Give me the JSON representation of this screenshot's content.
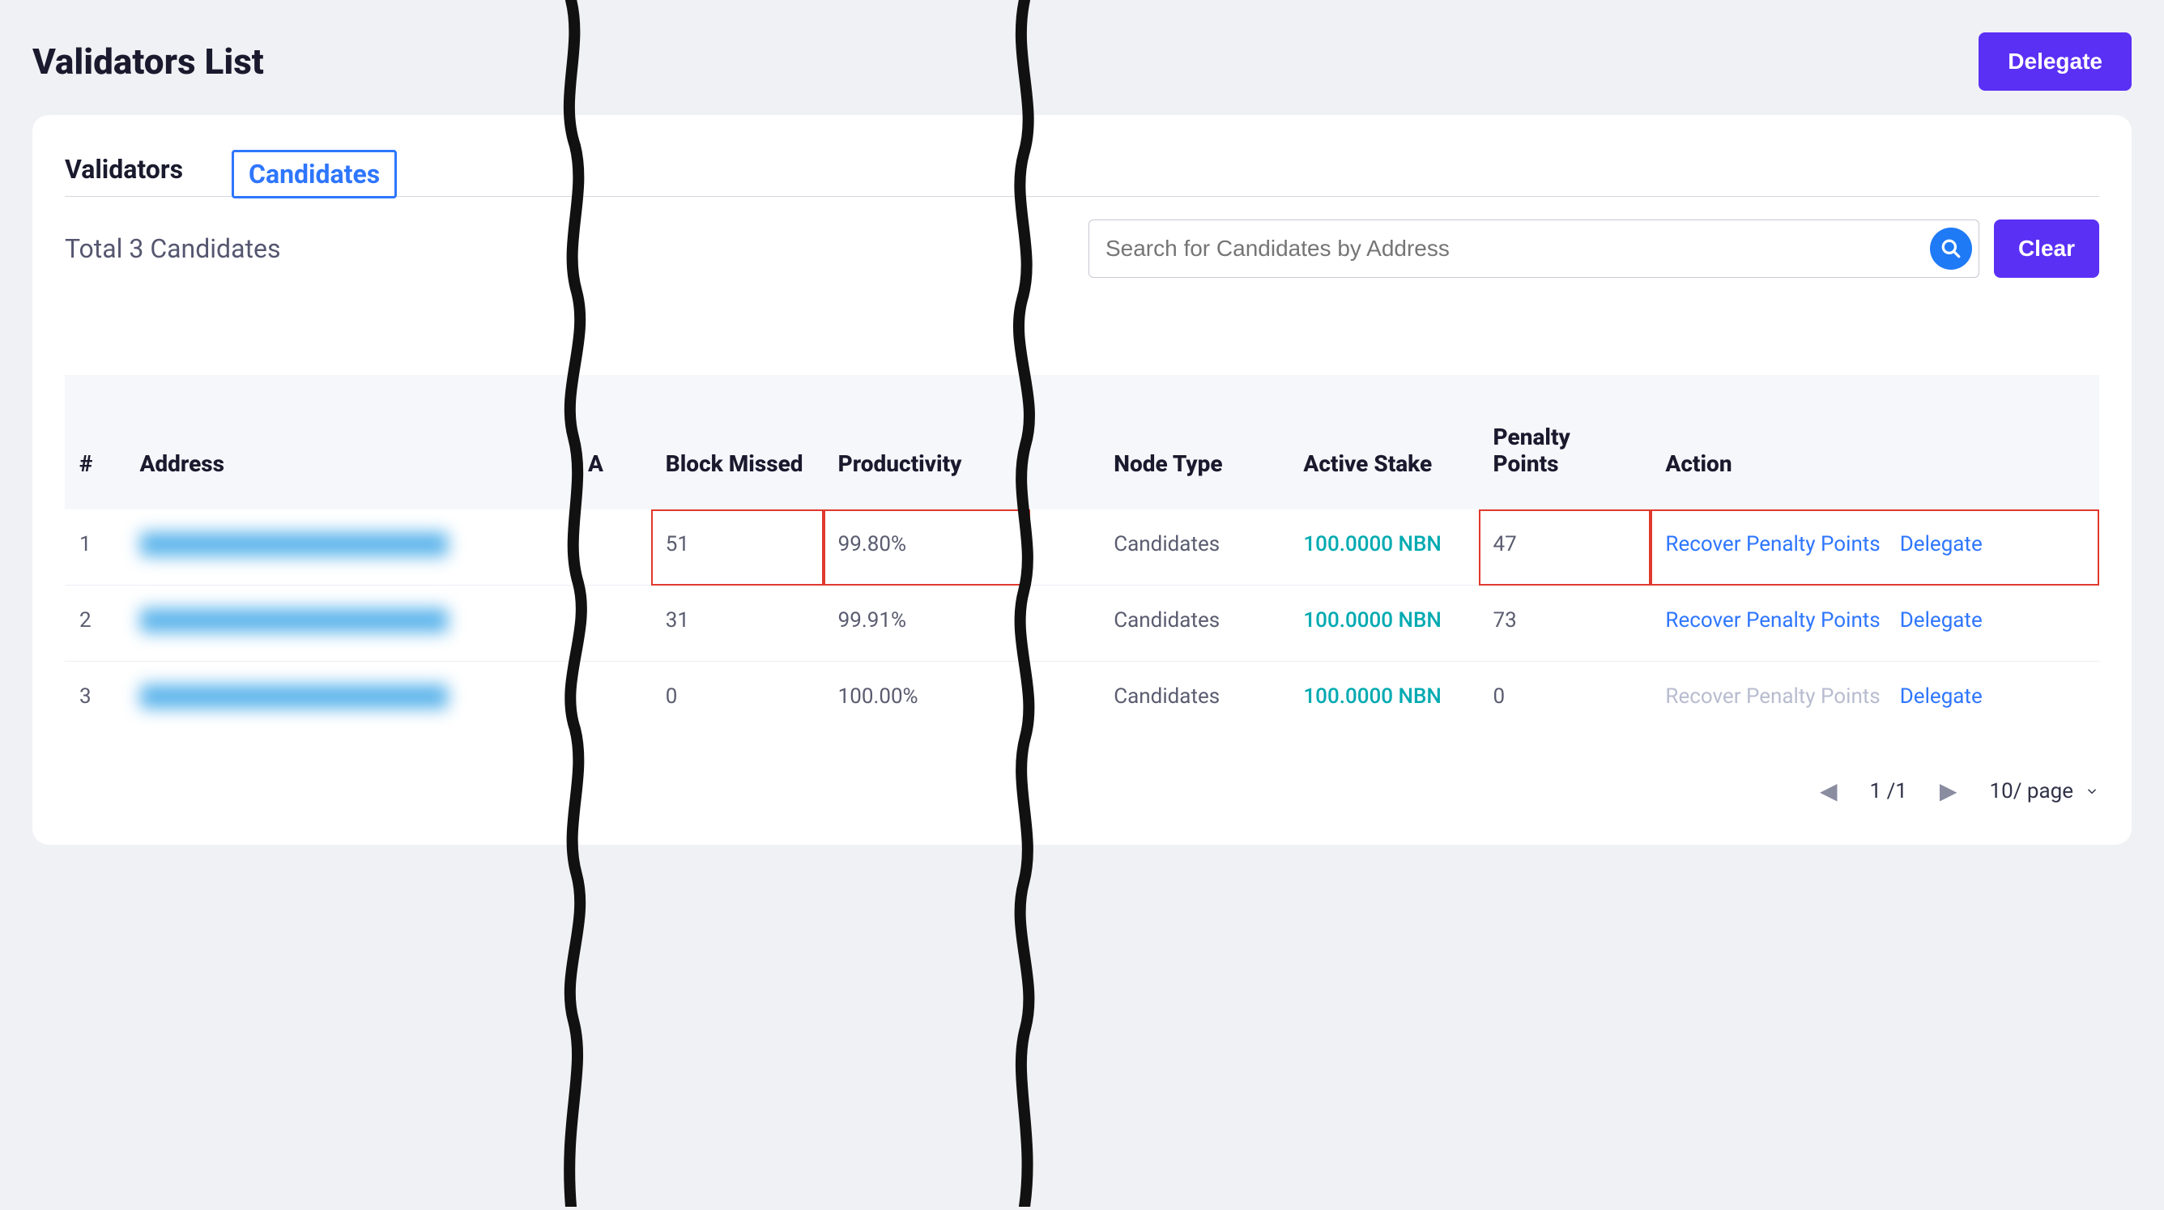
{
  "header": {
    "title": "Validators List",
    "delegate_label": "Delegate"
  },
  "tabs": {
    "validators": "Validators",
    "candidates": "Candidates"
  },
  "summary": {
    "total_text": "Total 3 Candidates"
  },
  "search": {
    "placeholder": "Search for Candidates by Address",
    "clear_label": "Clear"
  },
  "columns": {
    "idx": "#",
    "address": "Address",
    "a": "A",
    "block_missed": "Block Missed",
    "productivity": "Productivity",
    "node_type": "Node Type",
    "active_stake": "Active Stake",
    "penalty_points": "Penalty Points",
    "action": "Action"
  },
  "rows": [
    {
      "idx": "1",
      "block_missed": "51",
      "productivity": "99.80%",
      "node_type": "Candidates",
      "active_stake": "100.0000 NBN",
      "penalty_points": "47",
      "recover_label": "Recover Penalty Points",
      "recover_enabled": true,
      "delegate_label": "Delegate",
      "highlighted": true
    },
    {
      "idx": "2",
      "block_missed": "31",
      "productivity": "99.91%",
      "node_type": "Candidates",
      "active_stake": "100.0000 NBN",
      "penalty_points": "73",
      "recover_label": "Recover Penalty Points",
      "recover_enabled": true,
      "delegate_label": "Delegate",
      "highlighted": false
    },
    {
      "idx": "3",
      "block_missed": "0",
      "productivity": "100.00%",
      "node_type": "Candidates",
      "active_stake": "100.0000 NBN",
      "penalty_points": "0",
      "recover_label": "Recover Penalty Points",
      "recover_enabled": false,
      "delegate_label": "Delegate",
      "highlighted": false
    }
  ],
  "pager": {
    "current": "1",
    "sep": "/",
    "total": "1",
    "per_page": "10/ page"
  }
}
